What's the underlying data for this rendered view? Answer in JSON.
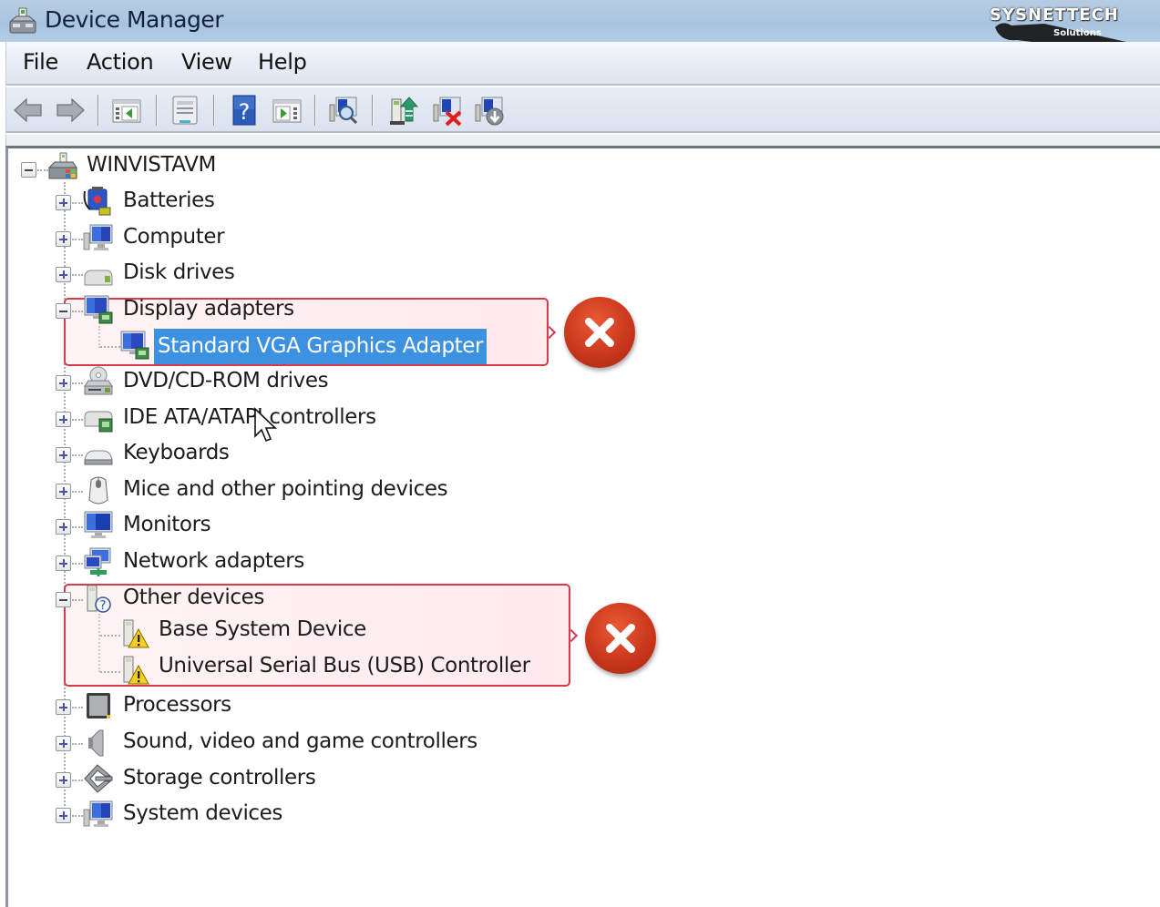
{
  "window": {
    "title": "Device Manager",
    "title_icon": "device-manager-icon",
    "watermark": {
      "name": "SYSNETTECH",
      "sub": "Solutions"
    }
  },
  "menu": {
    "items": [
      {
        "label": "File"
      },
      {
        "label": "Action"
      },
      {
        "label": "View"
      },
      {
        "label": "Help"
      }
    ]
  },
  "toolbar": {
    "buttons": [
      {
        "name": "back",
        "icon": "back-arrow-icon"
      },
      {
        "name": "forward",
        "icon": "forward-arrow-icon"
      },
      {
        "name": "show-hide-console-tree",
        "icon": "console-tree-icon"
      },
      {
        "name": "properties",
        "icon": "properties-icon"
      },
      {
        "name": "help",
        "icon": "help-icon"
      },
      {
        "name": "show-hide-action-pane",
        "icon": "action-pane-icon"
      },
      {
        "name": "scan-hardware-changes",
        "icon": "scan-hardware-icon"
      },
      {
        "name": "update-driver",
        "icon": "update-driver-icon"
      },
      {
        "name": "uninstall",
        "icon": "uninstall-icon"
      },
      {
        "name": "disable",
        "icon": "disable-icon"
      }
    ]
  },
  "tree": {
    "root": {
      "label": "WINVISTAVM",
      "expanded": true,
      "icon": "computer-root-icon"
    },
    "categories": [
      {
        "label": "Batteries",
        "icon": "battery-icon",
        "expanded": false
      },
      {
        "label": "Computer",
        "icon": "computer-icon",
        "expanded": false
      },
      {
        "label": "Disk drives",
        "icon": "disk-drive-icon",
        "expanded": false
      },
      {
        "label": "Display adapters",
        "icon": "display-adapter-icon",
        "expanded": true,
        "children": [
          {
            "label": "Standard VGA Graphics Adapter",
            "icon": "display-adapter-icon",
            "selected": true
          }
        ]
      },
      {
        "label": "DVD/CD-ROM drives",
        "icon": "dvd-drive-icon",
        "expanded": false
      },
      {
        "label": "IDE ATA/ATAPI controllers",
        "icon": "ide-controller-icon",
        "expanded": false
      },
      {
        "label": "Keyboards",
        "icon": "keyboard-icon",
        "expanded": false
      },
      {
        "label": "Mice and other pointing devices",
        "icon": "mouse-icon",
        "expanded": false
      },
      {
        "label": "Monitors",
        "icon": "monitor-icon",
        "expanded": false
      },
      {
        "label": "Network adapters",
        "icon": "network-adapter-icon",
        "expanded": false
      },
      {
        "label": "Other devices",
        "icon": "unknown-device-icon",
        "expanded": true,
        "children": [
          {
            "label": "Base System Device",
            "icon": "warning-device-icon"
          },
          {
            "label": "Universal Serial Bus (USB) Controller",
            "icon": "warning-device-icon"
          }
        ]
      },
      {
        "label": "Processors",
        "icon": "processor-icon",
        "expanded": false
      },
      {
        "label": "Sound, video and game controllers",
        "icon": "speaker-icon",
        "expanded": false
      },
      {
        "label": "Storage controllers",
        "icon": "storage-controller-icon",
        "expanded": false
      },
      {
        "label": "System devices",
        "icon": "system-device-icon",
        "expanded": false
      }
    ]
  },
  "annotations": [
    {
      "target": "Display adapters",
      "marker": "error-x-icon"
    },
    {
      "target": "Other devices",
      "marker": "error-x-icon"
    }
  ],
  "colors": {
    "selection": "#3c92e0",
    "callout_border": "#d83a4c",
    "error_badge": "#c7351b"
  }
}
